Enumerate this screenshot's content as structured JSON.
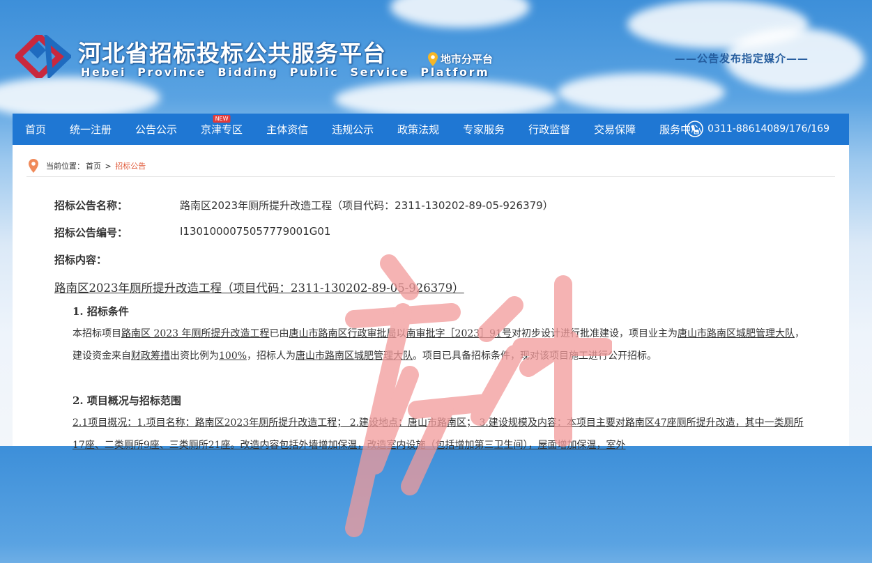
{
  "header": {
    "site_name_cn": "河北省招标投标公共服务平台",
    "site_name_en": "Hebei Province Bidding Public Service Platform",
    "sub_platform": "地市分平台",
    "media_tagline": "——公告发布指定媒介——"
  },
  "nav": {
    "items": [
      {
        "label": "首页"
      },
      {
        "label": "统一注册"
      },
      {
        "label": "公告公示"
      },
      {
        "label": "京津专区",
        "badge": "NEW"
      },
      {
        "label": "主体资信"
      },
      {
        "label": "违规公示"
      },
      {
        "label": "政策法规"
      },
      {
        "label": "专家服务"
      },
      {
        "label": "行政监督"
      },
      {
        "label": "交易保障"
      },
      {
        "label": "服务中心"
      }
    ],
    "phone": "0311-88614089/176/169"
  },
  "breadcrumb": {
    "prefix": "当前位置：",
    "home": "首页",
    "sep": " > ",
    "current": "招标公告"
  },
  "notice": {
    "name_label": "招标公告名称：",
    "name_value": "路南区2023年厕所提升改造工程（项目代码：2311-130202-89-05-926379）",
    "code_label": "招标公告编号：",
    "code_value": "I1301000075057779001G01",
    "content_label": "招标内容：",
    "doc_title": "路南区2023年厕所提升改造工程（项目代码：2311-130202-89-05-926379）",
    "sec1_title": "1. 招标条件",
    "sec1_para": {
      "p1": "本招标项目",
      "u1": "路南区 2023 年厕所提升改造工程",
      "p2": "已由",
      "u2": "唐山市路南区行政审批局",
      "p3": "以",
      "u3": "南审批字［2023］91号",
      "p4": "对初步设计进行批准建设，项目业主为",
      "u4": "唐山市路南区城肥管理大队",
      "p5": "，建设资金来自",
      "u5": "财政筹措",
      "p6": "出资比例为",
      "u6": "100%",
      "p7": "，招标人为",
      "u7": "唐山市路南区城肥管理大队",
      "p8": "。项目已具备招标条件，现对该项目施工进行公开招标。"
    },
    "sec2_title": "2. 项目概况与招标范围",
    "sec2_para": "2.1项目概况：1.项目名称：路南区2023年厕所提升改造工程；  2.建设地点：唐山市路南区；  3.建设规模及内容：本项目主要对路南区47座厕所提升改造，其中一类厕所17座、二类厕所9座、三类厕所21座。改造内容包括外墙增加保温，改造室内设施（包括增加第三卫生间），屋面增加保温，室外"
  },
  "colors": {
    "nav_bg": "#1f77d3",
    "breadcrumb_current": "#e05a3a",
    "stamp": "#f29a9a"
  }
}
